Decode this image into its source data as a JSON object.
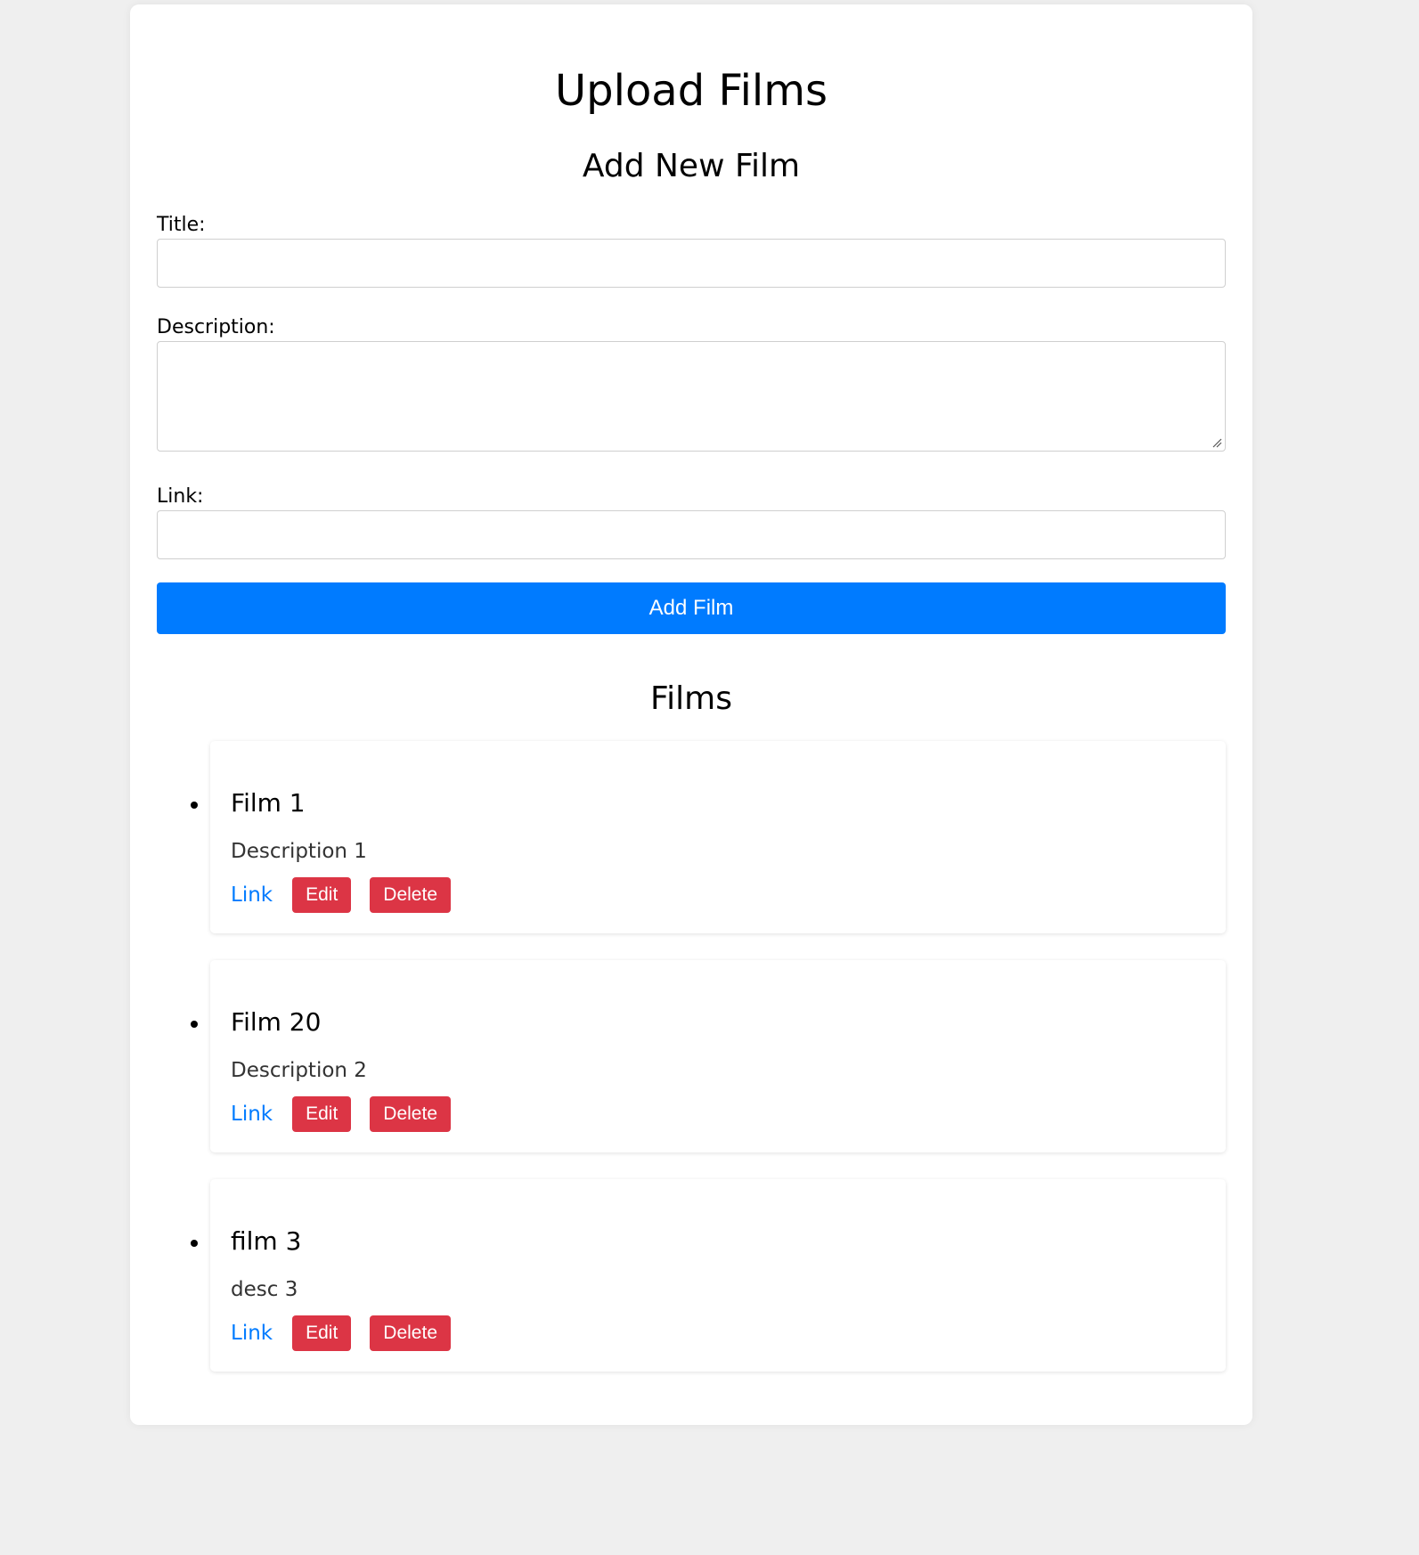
{
  "page": {
    "title": "Upload Films"
  },
  "form": {
    "heading": "Add New Film",
    "title_label": "Title:",
    "title_value": "",
    "description_label": "Description:",
    "description_value": "",
    "link_label": "Link:",
    "link_value": "",
    "submit_label": "Add Film"
  },
  "films": {
    "heading": "Films",
    "items": [
      {
        "title": "Film 1",
        "description": "Description 1",
        "link_label": "Link",
        "edit_label": "Edit",
        "delete_label": "Delete"
      },
      {
        "title": "Film 20",
        "description": "Description 2",
        "link_label": "Link",
        "edit_label": "Edit",
        "delete_label": "Delete"
      },
      {
        "title": "film 3",
        "description": "desc 3",
        "link_label": "Link",
        "edit_label": "Edit",
        "delete_label": "Delete"
      }
    ]
  },
  "colors": {
    "background": "#efefef",
    "card": "#ffffff",
    "primary": "#007bff",
    "danger": "#dc3545",
    "link": "#007bff"
  }
}
